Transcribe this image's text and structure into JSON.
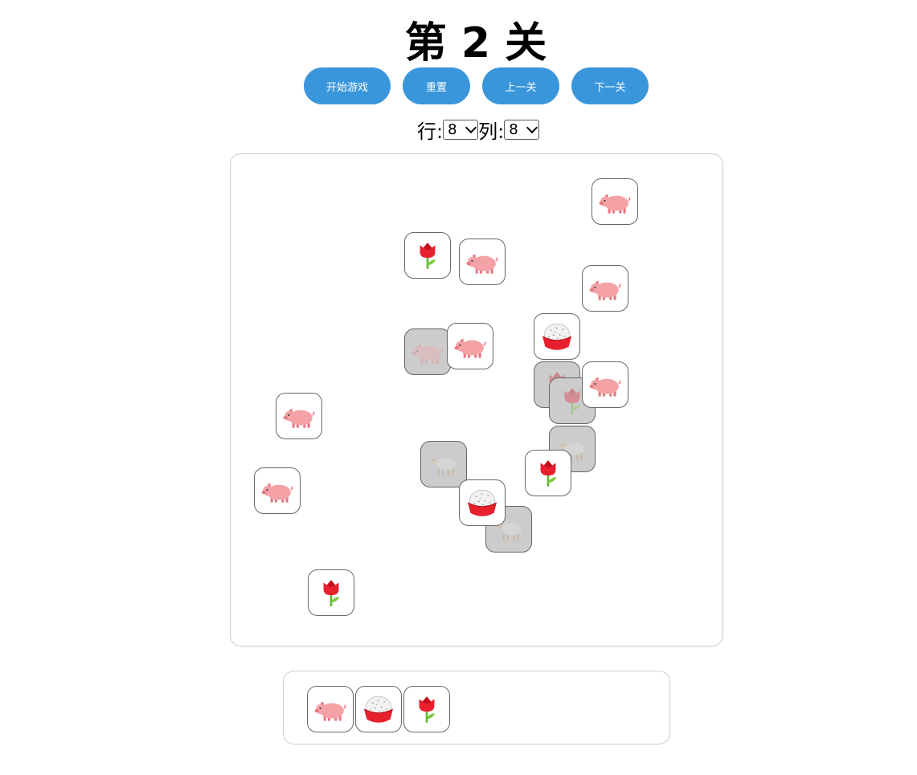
{
  "title": "第 2 关",
  "buttons": {
    "start": "开始游戏",
    "reset": "重置",
    "prev": "上一关",
    "next": "下一关"
  },
  "settings": {
    "rows_label": "行:",
    "rows_value": "8",
    "cols_label": "列:",
    "cols_value": "8"
  },
  "board_tiles": [
    {
      "icon": "pig",
      "state": "free"
    },
    {
      "icon": "tulip",
      "state": "free"
    },
    {
      "icon": "pig",
      "state": "free"
    },
    {
      "icon": "pig",
      "state": "free"
    },
    {
      "icon": "pig",
      "state": "covered"
    },
    {
      "icon": "pig",
      "state": "free"
    },
    {
      "icon": "rice-bowl",
      "state": "free"
    },
    {
      "icon": "tulip",
      "state": "covered"
    },
    {
      "icon": "tulip",
      "state": "covered"
    },
    {
      "icon": "pig",
      "state": "free"
    },
    {
      "icon": "pig",
      "state": "free"
    },
    {
      "icon": "lamb",
      "state": "covered"
    },
    {
      "icon": "lamb",
      "state": "covered"
    },
    {
      "icon": "tulip",
      "state": "free"
    },
    {
      "icon": "pig",
      "state": "free"
    },
    {
      "icon": "lamb",
      "state": "covered"
    },
    {
      "icon": "rice-bowl",
      "state": "free"
    },
    {
      "icon": "tulip",
      "state": "free"
    }
  ],
  "tray_tiles": [
    {
      "icon": "pig"
    },
    {
      "icon": "rice-bowl"
    },
    {
      "icon": "tulip"
    }
  ]
}
